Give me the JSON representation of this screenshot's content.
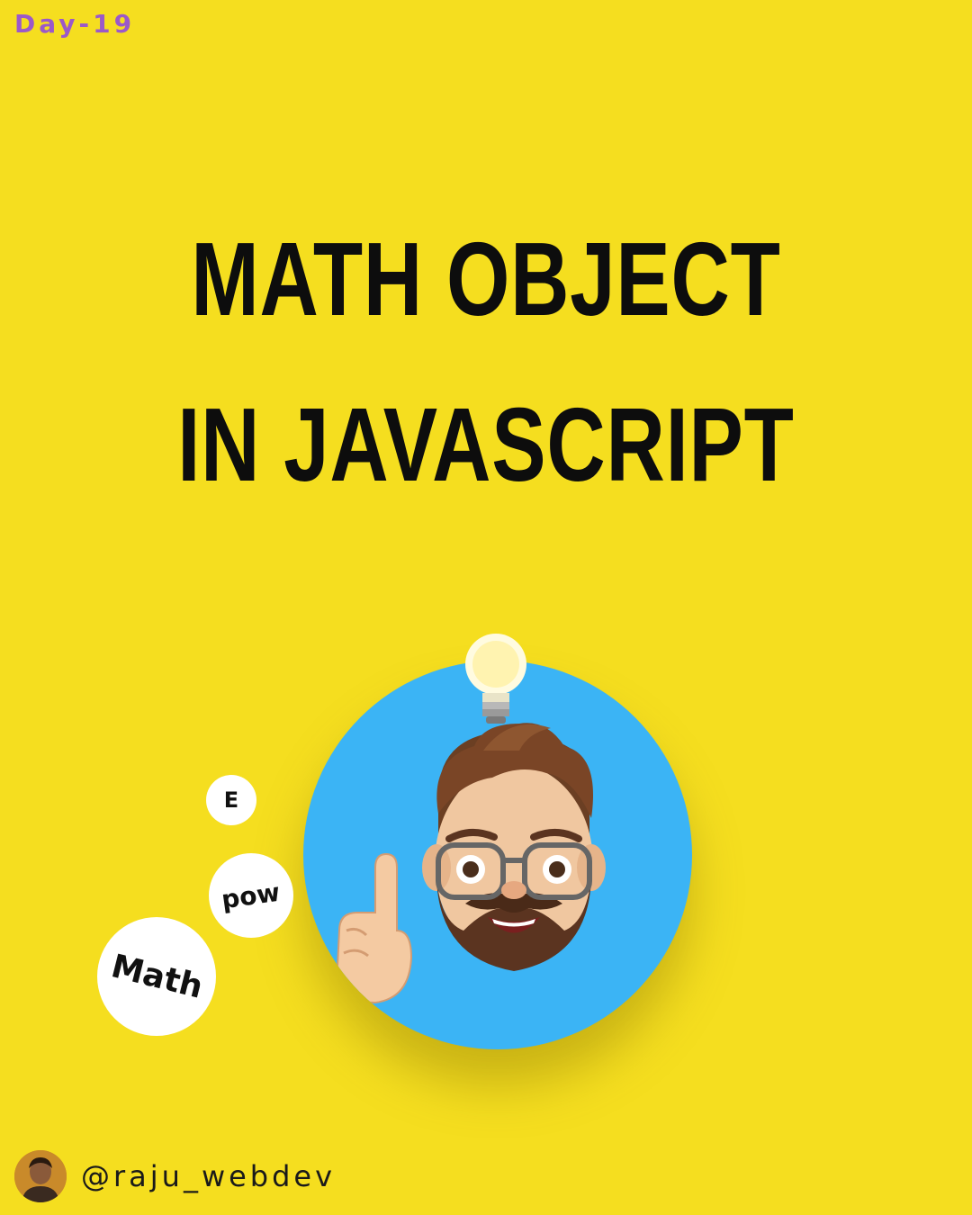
{
  "day_label": "Day-19",
  "title": {
    "line1": "MATH OBJECT",
    "line2": "IN JAVASCRIPT"
  },
  "bubbles": {
    "e": "E",
    "pow": "pow",
    "math": "Math"
  },
  "footer": {
    "handle": "@raju_webdev"
  },
  "colors": {
    "background": "#f5de1f",
    "accent_day": "#9b59c9",
    "circle": "#3bb4f5",
    "text": "#0d0d0d"
  },
  "icons": [
    "lightbulb-icon",
    "memoji-avatar",
    "profile-avatar"
  ]
}
